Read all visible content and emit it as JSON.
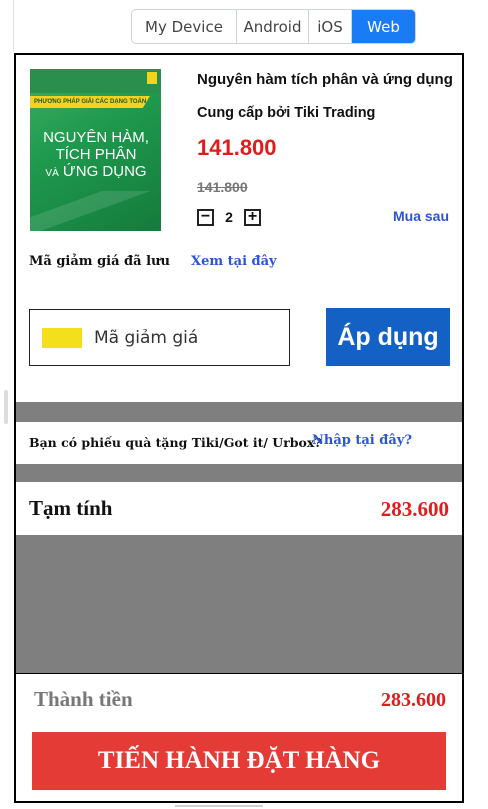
{
  "platform_tabs": [
    {
      "label": "My Device",
      "active": false
    },
    {
      "label": "Android",
      "active": false
    },
    {
      "label": "iOS",
      "active": false
    },
    {
      "label": "Web",
      "active": true
    }
  ],
  "product": {
    "cover": {
      "banner_text": "PHƯƠNG PHÁP GIẢI CÁC DẠNG TOÁN THPT",
      "line1": "NGUYÊN HÀM,",
      "line2": "TÍCH PHÂN",
      "line3_small": "VÀ",
      "line3": "ỨNG DỤNG"
    },
    "title": "Nguyên hàm tích phân và ứng dụng",
    "provider": "Cung cấp bởi Tiki Trading",
    "price": "141.800",
    "old_price": "141.800",
    "quantity": "2",
    "minus_label": "−",
    "plus_label": "+",
    "buy_later": "Mua sau"
  },
  "coupon": {
    "saved_label": "Mã giảm giá đã lưu",
    "see_here": "Xem tại đây",
    "placeholder": "Mã giảm giá",
    "apply": "Áp dụng"
  },
  "gift": {
    "prompt": "Bạn có phiếu quà tặng Tiki/Got it/ Urbox?",
    "link": "Nhập tại đây?"
  },
  "summary": {
    "subtotal_label": "Tạm tính",
    "subtotal_value": "283.600",
    "total_label": "Thành tiền",
    "total_value": "283.600",
    "checkout": "TIẾN HÀNH ĐẶT HÀNG"
  },
  "colors": {
    "accent_blue": "#1361c4",
    "link_blue": "#2b55d9",
    "price_red": "#e01d1d",
    "checkout_red": "#e43b36",
    "active_tab": "#1a7cf5",
    "divider_gray": "#7f7f7f"
  }
}
